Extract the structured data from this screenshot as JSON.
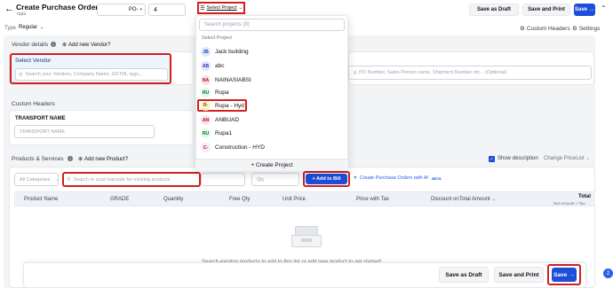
{
  "header": {
    "title": "Create Purchase Order",
    "subtitle": "rupa",
    "prefix": "PO-",
    "number": "4",
    "select_project": "Select Project",
    "save_draft": "Save as Draft",
    "save_print": "Save and Print",
    "save": "Save"
  },
  "toolbar": {
    "type_label": "Type",
    "type_value": "Regular",
    "custom_headers": "Custom Headers",
    "settings": "Settings"
  },
  "vendor": {
    "section_label": "Vendor details",
    "add_new": "Add new Vendor?",
    "select_label": "Select Vendor",
    "placeholder": "Search your Vendors, Company Name, GSTIN, tags...",
    "ref_placeholder": "g. PO Number, Sales Person name, Shipment Number etc... (Optional)"
  },
  "custom_headers": {
    "section_label": "Custom Headers",
    "field_label": "TRANSPORT NAME",
    "field_placeholder": "TRANSPORT NAME"
  },
  "products": {
    "section_label": "Products & Services",
    "add_new": "Add new Product?",
    "show_description": "Show description",
    "change_pricelist": "Change PriceList",
    "category": "All Categories",
    "search_placeholder": "Search or scan barcode for existing products",
    "qty_placeholder": "Qty",
    "add_to_bill": "+ Add to Bill",
    "ai_link": "Create Purchase Orders with AI",
    "ai_badge": "BETA",
    "columns": [
      "Product Name",
      "GRADE",
      "Quantity",
      "Free Qty",
      "Unit Price",
      "Price with Tax",
      "Discount on",
      "Total Amount",
      "Total"
    ],
    "total_sub": "Net Amount + Tax",
    "empty_text": "Search existing products to add to this list or add new product to get started!"
  },
  "dropdown": {
    "search_placeholder": "Search projects (8)",
    "group_label": "Select Project",
    "projects": [
      {
        "initials": "JB",
        "name": "Jack building",
        "bg": "#dbeafe",
        "fg": "#1e40af"
      },
      {
        "initials": "AB",
        "name": "abc",
        "bg": "#e0e7ff",
        "fg": "#3730a3"
      },
      {
        "initials": "NA",
        "name": "NAINASIABSI",
        "bg": "#fde2e2",
        "fg": "#9f1239"
      },
      {
        "initials": "RU",
        "name": "Rupa",
        "bg": "#dcfce7",
        "fg": "#166534"
      },
      {
        "initials": "R-",
        "name": "Rupa - Hyd",
        "bg": "#fef3c7",
        "fg": "#92400e"
      },
      {
        "initials": "AN",
        "name": "ANBUAD",
        "bg": "#fde2e2",
        "fg": "#9f1239"
      },
      {
        "initials": "RU",
        "name": "Rupa1",
        "bg": "#dcfce7",
        "fg": "#166534"
      },
      {
        "initials": "C-",
        "name": "Construction - HYD",
        "bg": "#fce7f3",
        "fg": "#9d174d"
      }
    ],
    "create": "+ Create Project"
  },
  "footer": {
    "save_draft": "Save as Draft",
    "save_print": "Save and Print",
    "save": "Save"
  },
  "notification_count": "2",
  "colors": {
    "accent": "#1d4ed8",
    "highlight": "#d21f1f"
  }
}
